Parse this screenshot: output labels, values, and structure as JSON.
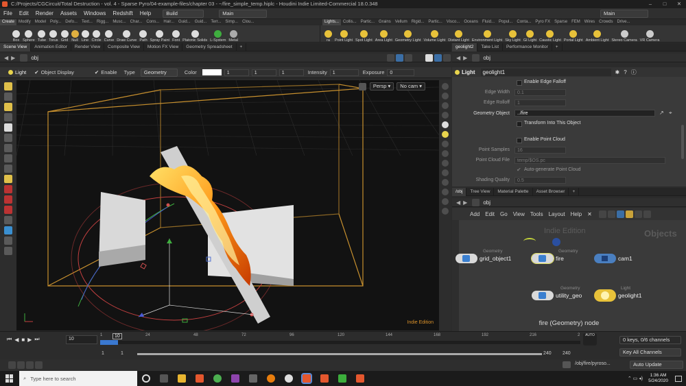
{
  "title_bar": {
    "text": "C:/Projects/CGCircuit/Total Destruction - vol. 4 - Sparse Pyro/04-example-files/chapter 03 - ~/fire_simple_temp.hiplc - Houdini Indie Limited-Commercial 18.0.348",
    "minimize": "–",
    "maximize": "□",
    "close": "✕"
  },
  "menu": {
    "items": [
      "File",
      "Edit",
      "Render",
      "Assets",
      "Windows",
      "Redshift",
      "Help"
    ],
    "desktop": "Build",
    "main": "Main",
    "desktop_right": "Main"
  },
  "shelf_tabs_left": [
    "Create",
    "Modify",
    "Model",
    "Poly...",
    "Defo...",
    "Text...",
    "Rigg...",
    "Musc...",
    "Char...",
    "Cons...",
    "Hair...",
    "Guid...",
    "Guid...",
    "Terr...",
    "Simp...",
    "Clou..."
  ],
  "shelf_tabs_right": [
    "Lights...",
    "Collis...",
    "Partic...",
    "Grains",
    "Vellum",
    "Rigid...",
    "Partic...",
    "Visco...",
    "Oceans",
    "Fluid...",
    "Popul...",
    "Conta...",
    "Pyro FX",
    "Sparse",
    "FEM",
    "Wires",
    "Crowds",
    "Drive..."
  ],
  "shelf_tools_left": [
    "Box",
    "Sphere",
    "Tube",
    "Torus",
    "Grid",
    "Null",
    "Line",
    "Circle",
    "Curve",
    "Draw Curve",
    "Path",
    "Spray Paint",
    "Font",
    "Platonic Solids",
    "L-System",
    "Metal"
  ],
  "shelf_tools_right": [
    "ra",
    "Point Light",
    "Spot Light",
    "Area Light",
    "Geometry Light",
    "Volume Light",
    "Distant Light",
    "Environment Light",
    "Sky Light",
    "GI Light",
    "Caustic Light",
    "Portal Light",
    "Ambient Light",
    "Stereo Camera",
    "VR Camera"
  ],
  "left_tabs": [
    "Scene View",
    "Animation Editor",
    "Render View",
    "Composite View",
    "Motion FX View",
    "Geometry Spreadsheet"
  ],
  "left_path": "obj",
  "viewport_toolbar": {
    "context": "Light",
    "object_display": "Object Display",
    "enable": "Enable",
    "type_label": "Type",
    "type_value": "Geometry",
    "color_label": "Color",
    "c1": "1",
    "c2": "1",
    "c3": "1",
    "intensity_label": "Intensity",
    "intensity_value": "1",
    "exposure_label": "Exposure",
    "exposure_value": "0"
  },
  "viewport": {
    "persp": "Persp ▾",
    "cam": "No cam ▾",
    "watermark": "Indie Edition"
  },
  "right_tabs_top": [
    "geolight2",
    "Take List",
    "Performance Monitor"
  ],
  "right_path_top": "obj",
  "parm": {
    "context": "Light",
    "name": "geolight1",
    "enable_edge_falloff": "Enable Edge Falloff",
    "edge_width_label": "Edge Width",
    "edge_width": "0.1",
    "edge_rolloff_label": "Edge Rolloff",
    "edge_rolloff": "1",
    "geometry_object_label": "Geometry Object",
    "geometry_object": "../fire",
    "transform_label": "Transform Into This Object",
    "enable_point_cloud": "Enable Point Cloud",
    "point_samples_label": "Point Samples",
    "point_samples": "16",
    "point_cloud_file_label": "Point Cloud File",
    "point_cloud_file": "temp/$OS.pc",
    "autogen": "Auto-generate Point Cloud",
    "shading_quality_label": "Shading Quality",
    "shading_quality": "0.5"
  },
  "right_tabs_bottom": [
    "/obj",
    "Tree View",
    "Material Palette",
    "Asset Browser"
  ],
  "right_path_bottom": "obj",
  "net_menu": [
    "Add",
    "Edit",
    "Go",
    "View",
    "Tools",
    "Layout",
    "Help"
  ],
  "network": {
    "indie": "Indie Edition",
    "objects": "Objects",
    "footer": "fire (Geometry) node",
    "nodes": [
      {
        "type": "Geometry",
        "label": "grid_object1"
      },
      {
        "type": "Geometry",
        "label": "fire"
      },
      {
        "type": "",
        "label": "cam1"
      },
      {
        "type": "Geometry",
        "label": "utility_geo"
      },
      {
        "type": "Light",
        "label": "geolight1"
      }
    ]
  },
  "timeline": {
    "frame": "10",
    "ticks": [
      "1",
      "24",
      "48",
      "72",
      "96",
      "120",
      "144",
      "168",
      "192",
      "216",
      "2"
    ],
    "cur_frame_marker": "10",
    "start1": "1",
    "start2": "1",
    "end1": "240",
    "end2": "240",
    "keys": "0 keys, 0/6 channels",
    "key_all": "Key All Channels",
    "auto": "AUTO"
  },
  "status": {
    "path": "/obj/fire/pyroso...",
    "auto_update": "Auto Update"
  },
  "taskbar": {
    "search": "Type here to search",
    "time": "1:36 AM",
    "date": "5/24/2020"
  }
}
